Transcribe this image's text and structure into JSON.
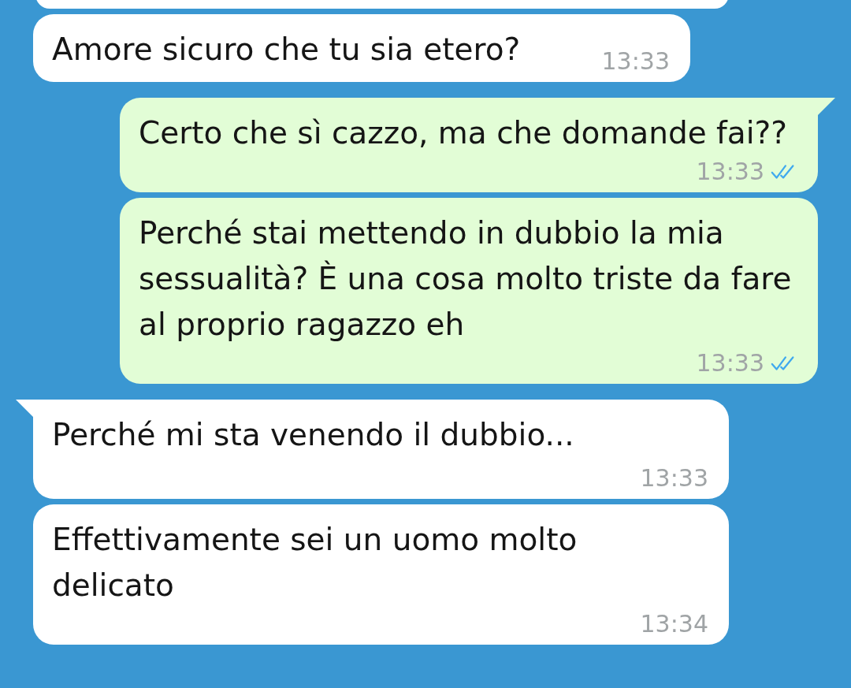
{
  "messages": [
    {
      "kind": "cut-off",
      "outgoing": false
    },
    {
      "kind": "message",
      "outgoing": false,
      "tail": false,
      "text": "Amore sicuro che tu sia etero?",
      "time": "13:33"
    },
    {
      "kind": "message",
      "outgoing": true,
      "tail": true,
      "text": "Certo che sì cazzo, ma che domande fai??",
      "time": "13:33",
      "read": true
    },
    {
      "kind": "message",
      "outgoing": true,
      "tail": false,
      "text": "Perché stai mettendo in dubbio la mia sessualità? È una cosa molto triste da fare al proprio ragazzo eh",
      "time": "13:33",
      "read": true
    },
    {
      "kind": "message",
      "outgoing": false,
      "tail": true,
      "text": "Perché mi sta venendo il dubbio...",
      "time": "13:33",
      "meta_below": true
    },
    {
      "kind": "message",
      "outgoing": false,
      "tail": false,
      "text": "Effettivamente sei un uomo molto delicato",
      "time": "13:34"
    }
  ]
}
